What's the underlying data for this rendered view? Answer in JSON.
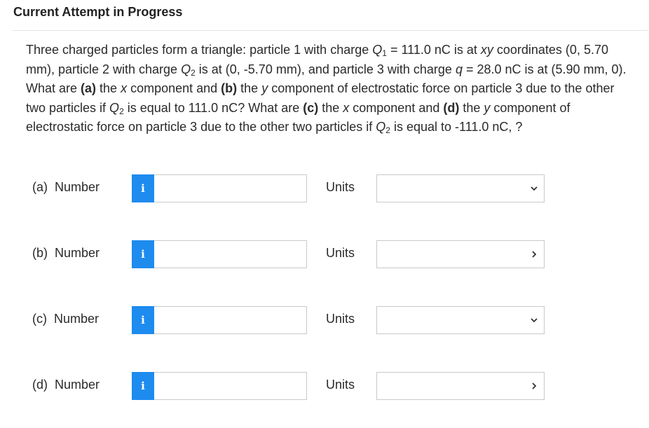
{
  "header": {
    "title": "Current Attempt in Progress"
  },
  "question": {
    "intro": "Three charged particles form a triangle: particle 1 with charge ",
    "q1_sym": "Q",
    "q1_sub": "1",
    "q1_rest": " = 111.0 nC is at ",
    "xy": "xy",
    "coords_1": " coordinates (0, 5.70 mm), particle 2 with charge ",
    "q2_sym": "Q",
    "q2_sub": "2",
    "coords_2": " is at (0, -5.70 mm), and particle 3 with charge ",
    "q3_sym": "q",
    "q3_rest": " = 28.0 nC is at (5.90 mm, 0). What are ",
    "a_tag": "(a)",
    "the_1": " the ",
    "x_1": "x",
    "comp_and": " component and ",
    "b_tag": "(b)",
    "the_2": " the ",
    "y_1": "y",
    "force_1": " component of electrostatic force on particle 3 due to the other two particles if ",
    "q2b_sym": "Q",
    "q2b_sub": "2",
    "equal_1": " is equal to 111.0 nC? What are ",
    "c_tag": "(c)",
    "the_3": " the ",
    "x_2": "x",
    "comp_and_2": " component and ",
    "d_tag": "(d)",
    "the_4": " the ",
    "y_2": "y",
    "force_2": " component of electrostatic force on particle 3 due to the other two particles if ",
    "q2c_sym": "Q",
    "q2c_sub": "2",
    "equal_2": " is equal to -111.0 nC, ?"
  },
  "parts": [
    {
      "label": "(a)  Number",
      "info_icon": "i",
      "value": "",
      "units_label": "Units",
      "units_selected": ""
    },
    {
      "label": "(b)  Number",
      "info_icon": "i",
      "value": "",
      "units_label": "Units",
      "units_selected": ""
    },
    {
      "label": "(c)  Number",
      "info_icon": "i",
      "value": "",
      "units_label": "Units",
      "units_selected": ""
    },
    {
      "label": "(d)  Number",
      "info_icon": "i",
      "value": "",
      "units_label": "Units",
      "units_selected": ""
    }
  ],
  "colors": {
    "info_button": "#1e8bef",
    "border": "#c9c9c9"
  }
}
